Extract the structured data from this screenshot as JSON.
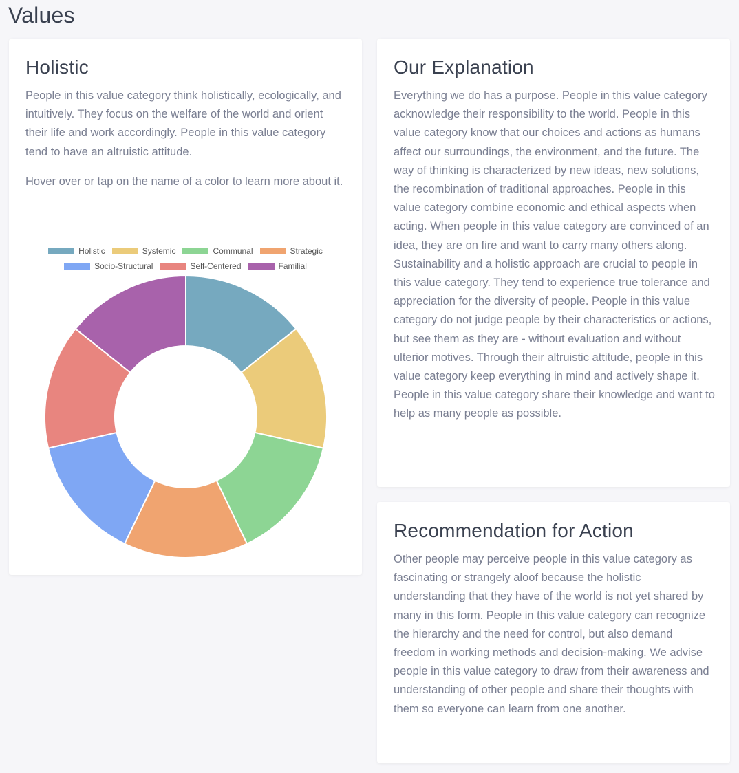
{
  "page": {
    "title": "Values"
  },
  "holistic": {
    "title": "Holistic",
    "description": "People in this value category think holistically, ecologically, and intuitively. They focus on the welfare of the world and orient their life and work accordingly. People in this value category tend to have an altruistic attitude.",
    "hint": "Hover over or tap on the name of a color to learn more about it."
  },
  "explanation": {
    "title": "Our Explanation",
    "text": "Everything we do has a purpose. People in this value category acknowledge their responsibility to the world. People in this value category know that our choices and actions as humans affect our surroundings, the environment, and the future. The way of thinking is characterized by new ideas, new solutions, the recombination of traditional approaches. People in this value category combine economic and ethical aspects when acting. When people in this value category are convinced of an idea, they are on fire and want to carry many others along. Sustainability and a holistic approach are crucial to people in this value category. They tend to experience true tolerance and appreciation for the diversity of people. People in this value category do not judge people by their characteristics or actions, but see them as they are - without evaluation and without ulterior motives. Through their altruistic attitude, people in this value category keep everything in mind and actively shape it. People in this value category share their knowledge and want to help as many people as possible."
  },
  "recommendation": {
    "title": "Recommendation for Action",
    "text": "Other people may perceive people in this value category as fascinating or strangely aloof because the holistic understanding that they have of the world is not yet shared by many in this form. People in this value category can recognize the hierarchy and the need for control, but also demand freedom in working methods and decision-making. We advise people in this value category to draw from their awareness and understanding of other people and share their thoughts with them so everyone can learn from one another."
  },
  "chart_data": {
    "type": "pie",
    "variant": "doughnut",
    "legend_position": "top",
    "categories": [
      "Holistic",
      "Systemic",
      "Communal",
      "Strategic",
      "Socio-Structural",
      "Self-Centered",
      "Familial"
    ],
    "values": [
      1,
      1,
      1,
      1,
      1,
      1,
      1
    ],
    "colors": [
      "#76a9bf",
      "#ebcb7a",
      "#8dd594",
      "#f0a470",
      "#7fa7f4",
      "#e8857f",
      "#a862ab"
    ]
  }
}
